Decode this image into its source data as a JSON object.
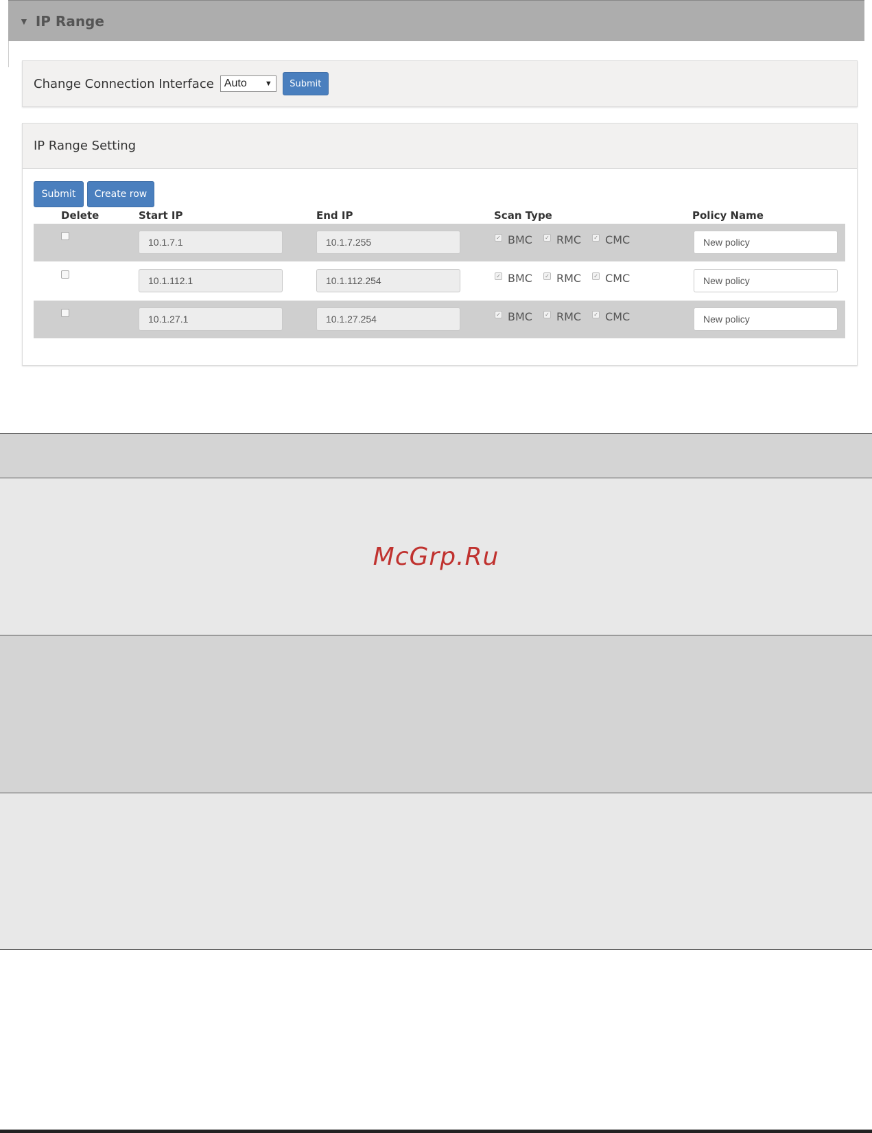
{
  "ip_range": {
    "title": "IP Range"
  },
  "connection": {
    "label": "Change Connection Interface",
    "select_value": "Auto",
    "submit_label": "Submit"
  },
  "range_setting": {
    "title": "IP Range Setting",
    "submit_label": "Submit",
    "create_row_label": "Create row",
    "columns": {
      "delete": "Delete",
      "start_ip": "Start IP",
      "end_ip": "End IP",
      "scan_type": "Scan Type",
      "policy_name": "Policy Name"
    },
    "scan_labels": {
      "bmc": "BMC",
      "rmc": "RMC",
      "cmc": "CMC"
    },
    "rows": [
      {
        "start_ip": "10.1.7.1",
        "end_ip": "10.1.7.255",
        "policy": "New policy",
        "delete": false,
        "bmc": true,
        "rmc": true,
        "cmc": true
      },
      {
        "start_ip": "10.1.112.1",
        "end_ip": "10.1.112.254",
        "policy": "New policy",
        "delete": false,
        "bmc": true,
        "rmc": true,
        "cmc": true
      },
      {
        "start_ip": "10.1.27.1",
        "end_ip": "10.1.27.254",
        "policy": "New policy",
        "delete": false,
        "bmc": true,
        "rmc": true,
        "cmc": true
      }
    ]
  },
  "watermark": "McGrp.Ru",
  "colors": {
    "accent": "#4a7fbe",
    "header_bg": "#adadad",
    "watermark": "#c0322f"
  }
}
